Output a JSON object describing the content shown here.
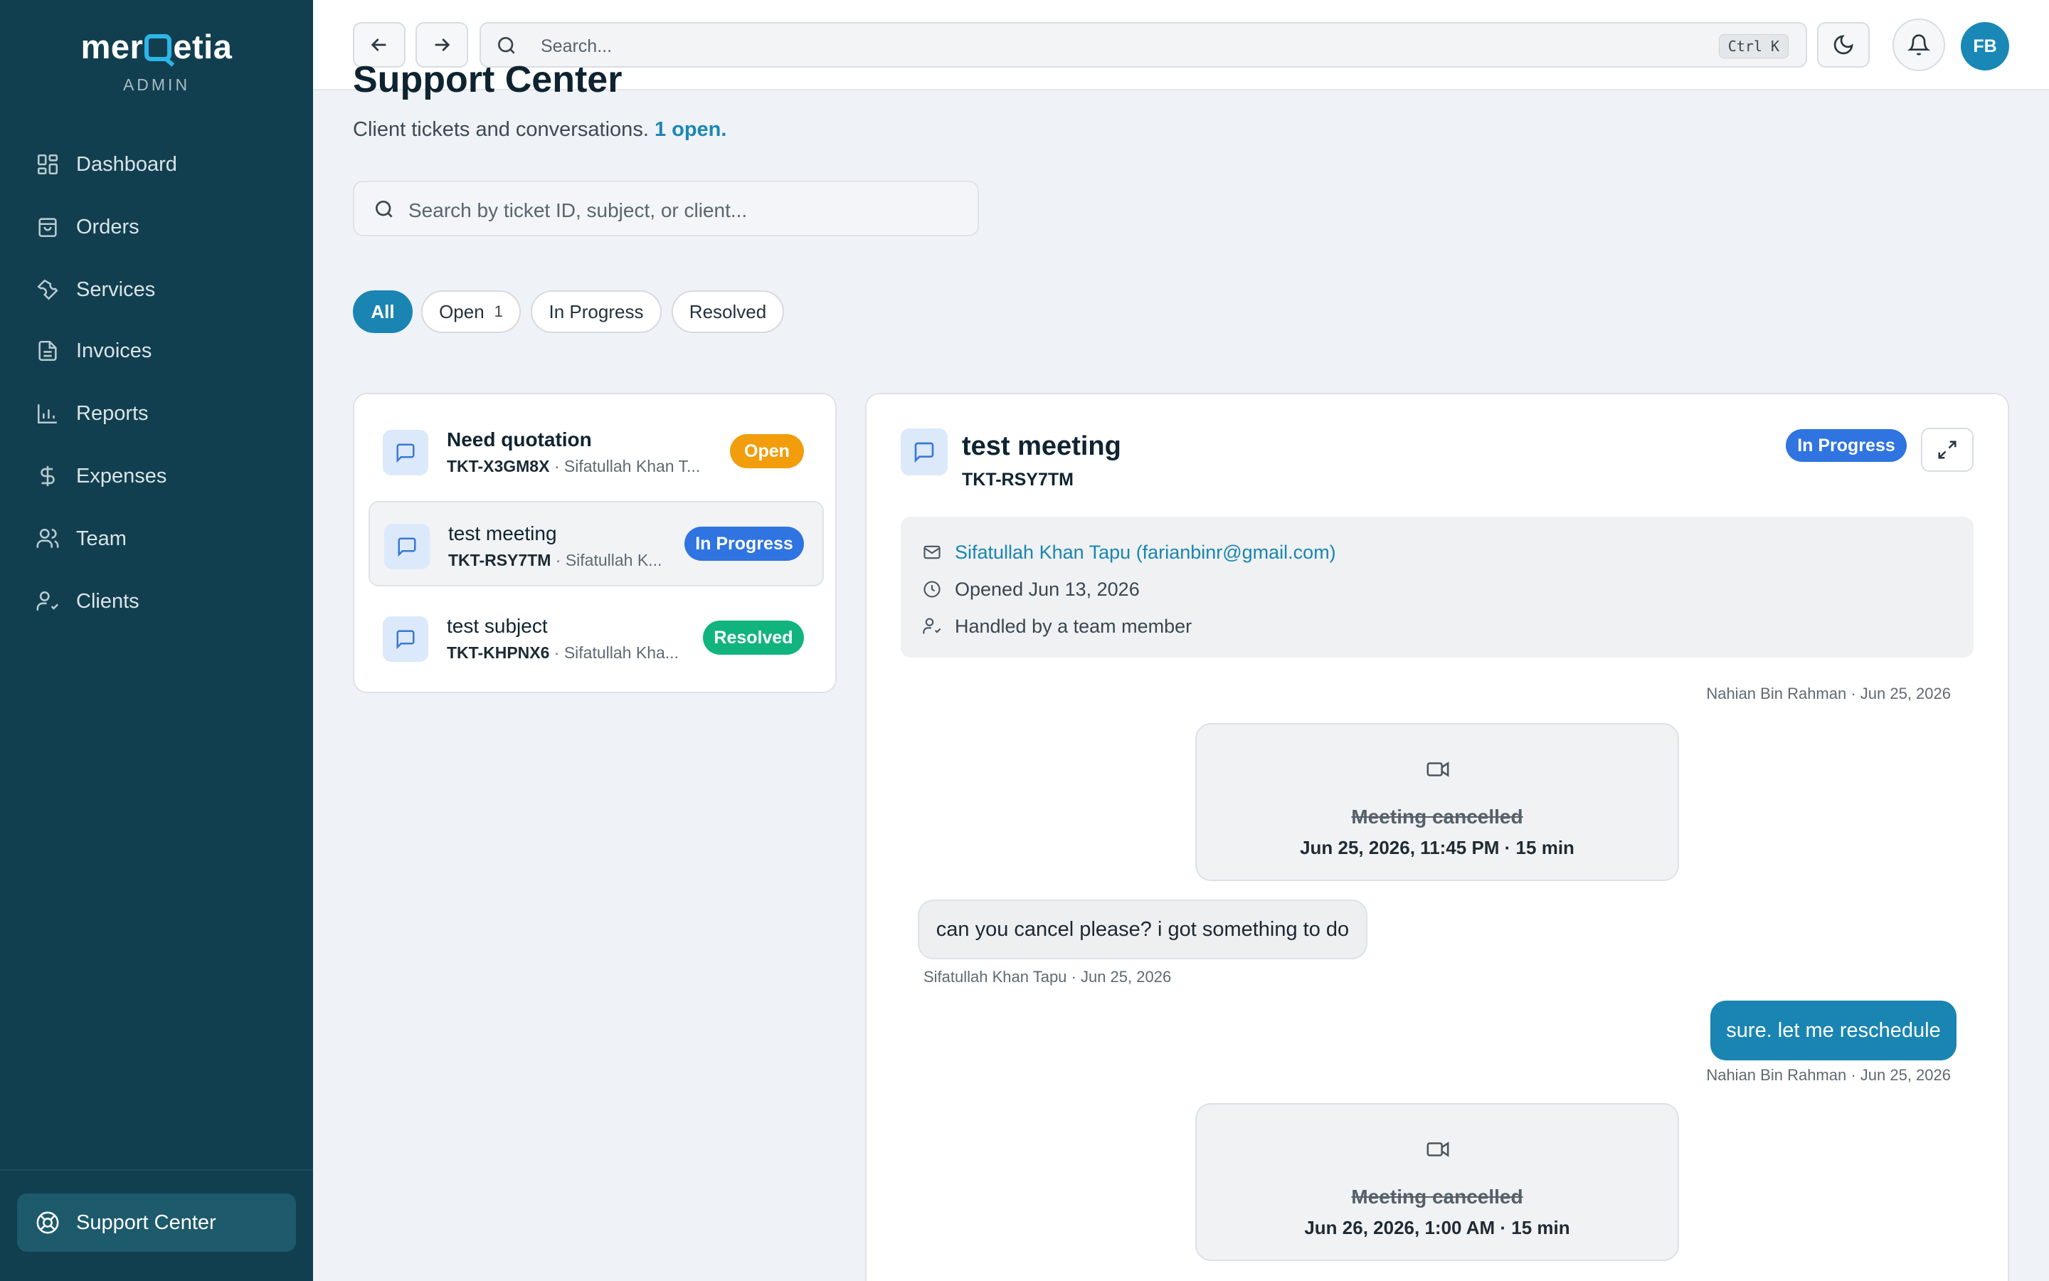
{
  "brand": {
    "logo_pre": "mer",
    "logo_post": "etia",
    "subtitle": "ADMIN"
  },
  "sidebar": {
    "items": [
      {
        "label": "Dashboard",
        "icon": "dashboard-grid-icon"
      },
      {
        "label": "Orders",
        "icon": "shopping-bag-icon"
      },
      {
        "label": "Services",
        "icon": "wrench-icon"
      },
      {
        "label": "Invoices",
        "icon": "document-icon"
      },
      {
        "label": "Reports",
        "icon": "bar-chart-icon"
      },
      {
        "label": "Expenses",
        "icon": "dollar-icon"
      },
      {
        "label": "Team",
        "icon": "users-icon"
      },
      {
        "label": "Clients",
        "icon": "user-check-icon"
      }
    ],
    "active": {
      "label": "Support Center",
      "icon": "lifebuoy-icon"
    }
  },
  "topbar": {
    "search_placeholder": "Search...",
    "shortcut": "Ctrl K",
    "avatar_initials": "FB"
  },
  "page": {
    "title": "Support Center",
    "subtitle": "Client tickets and conversations.",
    "open_summary": "1 open.",
    "search_placeholder": "Search by ticket ID, subject, or client..."
  },
  "filters": [
    {
      "label": "All",
      "count": ""
    },
    {
      "label": "Open",
      "count": "1"
    },
    {
      "label": "In Progress",
      "count": ""
    },
    {
      "label": "Resolved",
      "count": ""
    }
  ],
  "tickets": [
    {
      "subject": "Need quotation",
      "id": "TKT-X3GM8X",
      "client": "· Sifatullah Khan T...",
      "status": "Open",
      "status_color": "#f29d0c"
    },
    {
      "subject": "test meeting",
      "id": "TKT-RSY7TM",
      "client": "· Sifatullah K...",
      "status": "In Progress",
      "status_color": "#2f74e0"
    },
    {
      "subject": "test subject",
      "id": "TKT-KHPNX6",
      "client": "· Sifatullah Kha...",
      "status": "Resolved",
      "status_color": "#12b47e"
    }
  ],
  "detail": {
    "title": "test meeting",
    "id": "TKT-RSY7TM",
    "status": "In Progress",
    "email": "Sifatullah Khan Tapu (farianbinr@gmail.com)",
    "opened": "Opened Jun 13, 2026",
    "handled": "Handled by a team member",
    "messages": [
      {
        "meta": "Nahian Bin Rahman · Jun 25, 2026"
      },
      {
        "type": "meeting",
        "status": "Meeting cancelled",
        "time": "Jun 25, 2026, 11:45 PM · 15 min"
      },
      {
        "text": "can you cancel please? i got something to do",
        "meta": "Sifatullah Khan Tapu · Jun 25, 2026"
      },
      {
        "text": "sure. let me reschedule",
        "meta": "Nahian Bin Rahman · Jun 25, 2026"
      },
      {
        "type": "meeting",
        "status": "Meeting cancelled",
        "time": "Jun 26, 2026, 1:00 AM · 15 min"
      }
    ]
  },
  "colors": {
    "sidebar": "#123f4f",
    "accent": "#1a85b2",
    "in_progress": "#2f74e0",
    "open": "#f29d0c",
    "resolved": "#12b47e"
  }
}
